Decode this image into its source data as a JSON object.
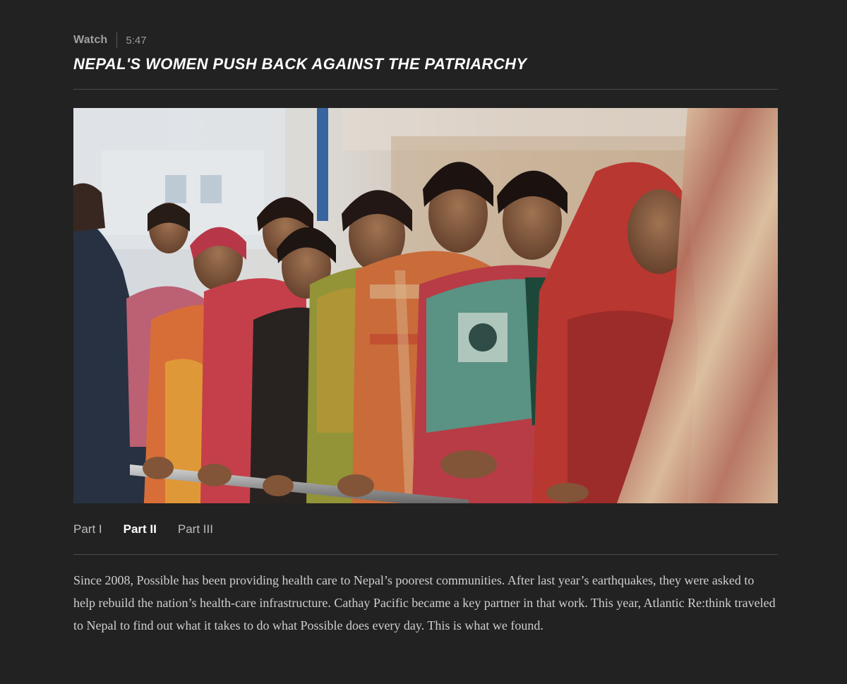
{
  "header": {
    "watch_label": "Watch",
    "duration": "5:47",
    "title": "NEPAL'S WOMEN PUSH BACK AGAINST THE PATRIARCHY"
  },
  "video": {
    "description": "Still frame of a line of Nepali women in colorful shawls leaning on a metal rail"
  },
  "parts": [
    {
      "label": "Part I",
      "active": false
    },
    {
      "label": "Part II",
      "active": true
    },
    {
      "label": "Part III",
      "active": false
    }
  ],
  "description": "Since 2008, Possible has been providing health care to Nepal’s poorest communities. After last year’s earthquakes, they were asked to help rebuild the nation’s health-care infrastructure. Cathay Pacific became a key partner in that work. This year, Atlantic Re:think traveled to Nepal to find out what it takes to do what Possible does every day. This is what we found.",
  "colors": {
    "background": "#222222",
    "title": "#ffffff",
    "text": "#cfcfcf",
    "muted": "#9a9a9a",
    "rule": "#4a4a4a"
  }
}
